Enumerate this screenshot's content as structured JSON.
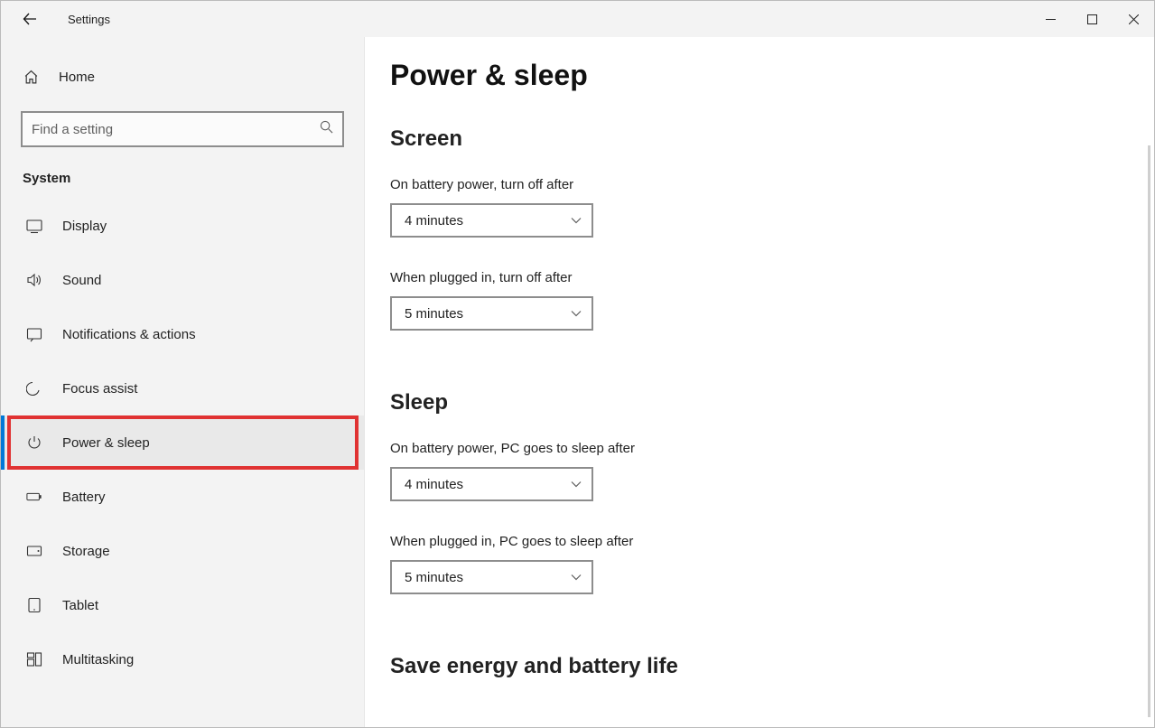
{
  "titlebar": {
    "title": "Settings"
  },
  "sidebar": {
    "home": "Home",
    "search_placeholder": "Find a setting",
    "category": "System",
    "items": [
      {
        "label": "Display"
      },
      {
        "label": "Sound"
      },
      {
        "label": "Notifications & actions"
      },
      {
        "label": "Focus assist"
      },
      {
        "label": "Power & sleep"
      },
      {
        "label": "Battery"
      },
      {
        "label": "Storage"
      },
      {
        "label": "Tablet"
      },
      {
        "label": "Multitasking"
      }
    ]
  },
  "content": {
    "page_title": "Power & sleep",
    "screen": {
      "heading": "Screen",
      "battery_label": "On battery power, turn off after",
      "battery_value": "4 minutes",
      "plugged_label": "When plugged in, turn off after",
      "plugged_value": "5 minutes"
    },
    "sleep": {
      "heading": "Sleep",
      "battery_label": "On battery power, PC goes to sleep after",
      "battery_value": "4 minutes",
      "plugged_label": "When plugged in, PC goes to sleep after",
      "plugged_value": "5 minutes"
    },
    "save_heading": "Save energy and battery life"
  }
}
